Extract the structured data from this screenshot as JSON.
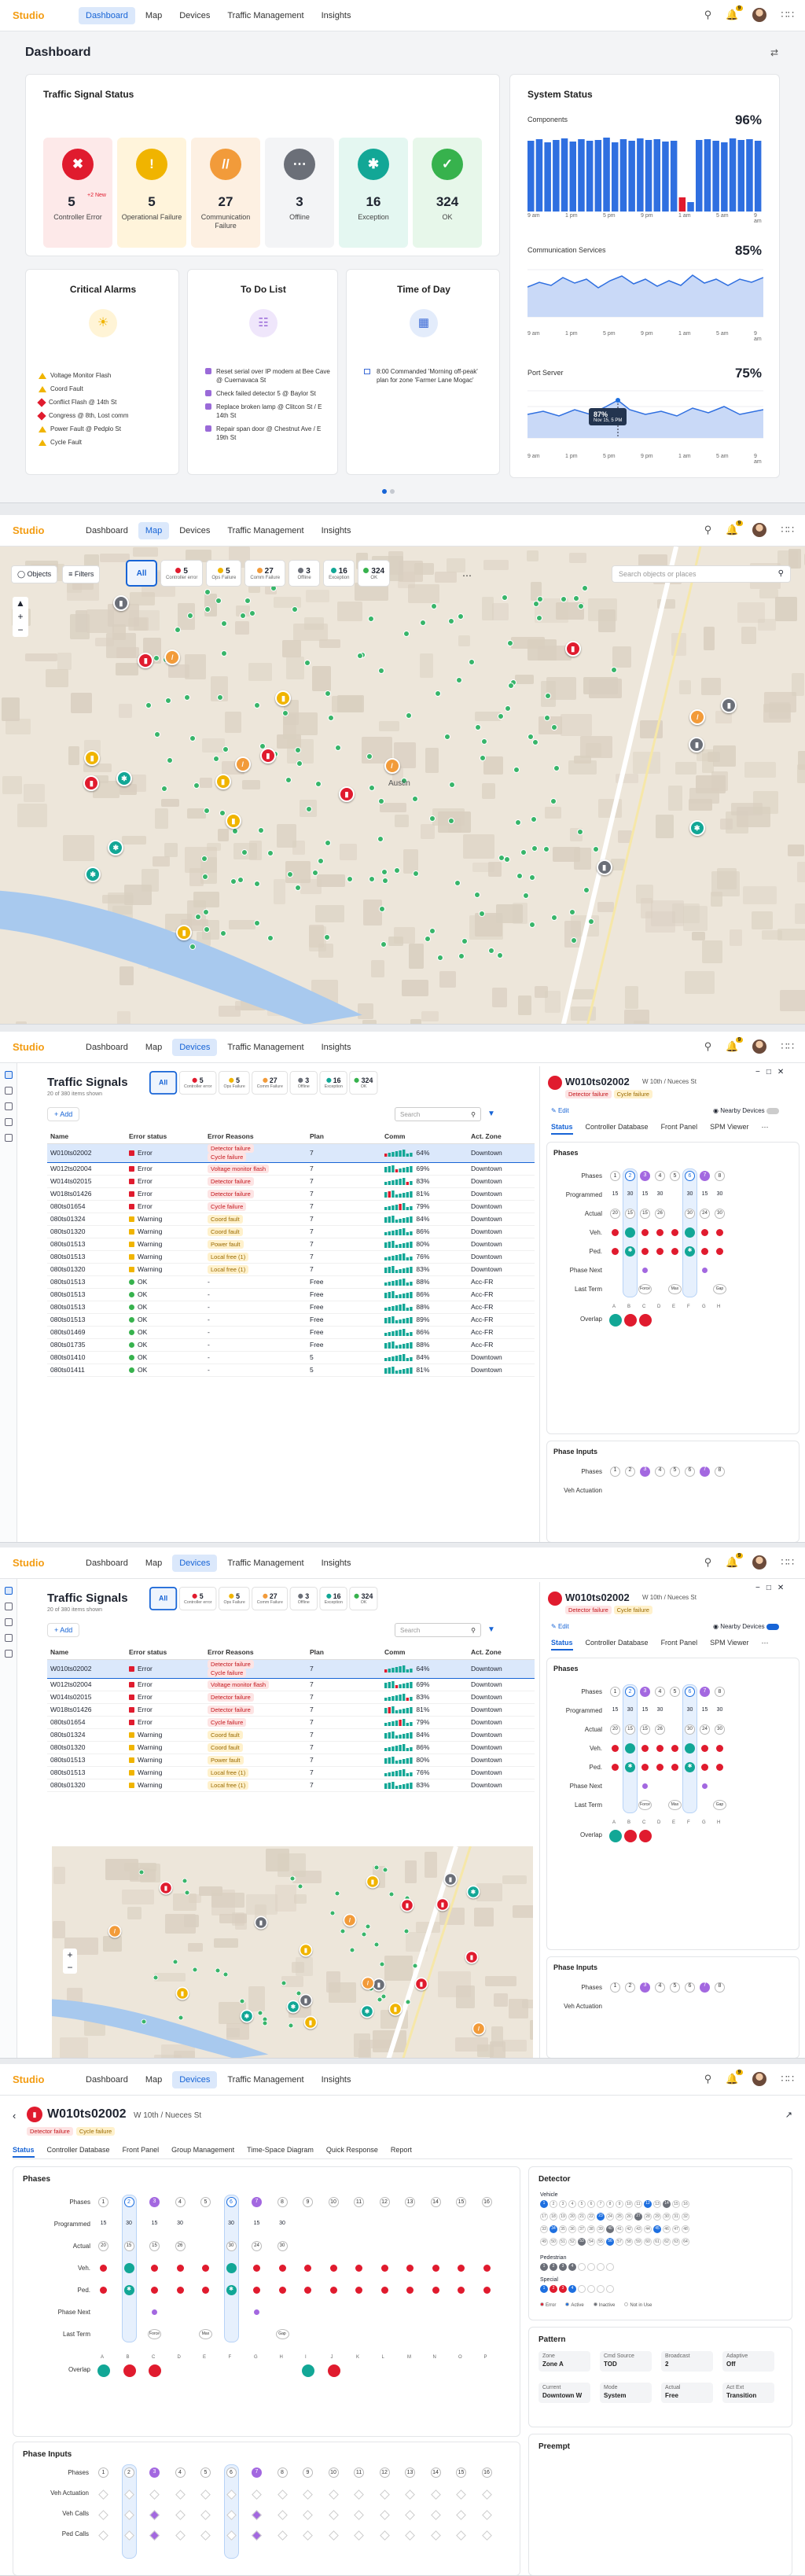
{
  "app": {
    "brand": "Studio",
    "nav": [
      "Dashboard",
      "Map",
      "Devices",
      "Traffic Management",
      "Insights"
    ],
    "bell_count": "9"
  },
  "dashboard": {
    "title": "Dashboard",
    "signal_status": {
      "title": "Traffic Signal Status",
      "tiles": [
        {
          "num": "5",
          "sub": "+2",
          "note": "New",
          "label": "Controller Error",
          "bg": "#fde9e9",
          "ic": "#e01b2e",
          "icon": "diamond-x-icon"
        },
        {
          "num": "5",
          "label": "Operational Failure",
          "bg": "#fff4db",
          "ic": "#f0b400",
          "icon": "warning-icon"
        },
        {
          "num": "27",
          "label": "Communication Failure",
          "bg": "#fdf0e2",
          "ic": "#f29b3a",
          "icon": "no-signal-icon"
        },
        {
          "num": "3",
          "label": "Offline",
          "bg": "#f3f4f6",
          "ic": "#6b6f78",
          "icon": "dots-icon"
        },
        {
          "num": "16",
          "label": "Exception",
          "bg": "#e4f7f1",
          "ic": "#12a796",
          "icon": "asterisk-icon"
        },
        {
          "num": "324",
          "label": "OK",
          "bg": "#e7f7ea",
          "ic": "#37b24d",
          "icon": "check-icon"
        }
      ]
    },
    "critical_alarms": {
      "title": "Critical Alarms",
      "items": [
        {
          "text": "Voltage Monitor Flash",
          "kind": "warn"
        },
        {
          "text": "Coord Fault",
          "kind": "warn"
        },
        {
          "text": "Conflict Flash @ 14th St",
          "kind": "err"
        },
        {
          "text": "Congress @ 8th, Lost comm",
          "kind": "err"
        },
        {
          "text": "Power Fault @ Pedplo St",
          "kind": "warn"
        },
        {
          "text": "Cycle Fault",
          "kind": "warn"
        }
      ]
    },
    "todo": {
      "title": "To Do List",
      "items": [
        "Reset serial over IP modem at Bee Cave @ Cuernavaca St",
        "Check failed detector 5 @ Baylor St",
        "Replace broken lamp @ Clitcon St / E 14th St",
        "Repair span door @ Chestnut Ave / E 19th St"
      ]
    },
    "time_of_day": {
      "title": "Time of Day",
      "text": "8:00 Commanded 'Morning off-peak' plan for zone 'Farmer Lane Mogac'"
    },
    "system_status": {
      "title": "System Status",
      "components": {
        "label": "Components",
        "pct": "96%",
        "ticks": [
          "9 am",
          "1 pm",
          "5 pm",
          "9 pm",
          "1 am",
          "5 am",
          "9 am"
        ]
      },
      "comm": {
        "label": "Communication Services",
        "pct": "85%",
        "ticks": [
          "9 am",
          "1 pm",
          "5 pm",
          "9 pm",
          "1 am",
          "5 am",
          "9 am"
        ]
      },
      "port": {
        "label": "Port Server",
        "pct": "75%",
        "tooltip_pct": "87%",
        "tooltip_time": "Nov 15, 5 PM",
        "ticks": [
          "9 am",
          "1 pm",
          "5 pm",
          "9 pm",
          "1 am",
          "5 am",
          "9 am"
        ]
      }
    }
  },
  "filters": {
    "objects": "Objects",
    "filters": "Filters",
    "search_placeholder": "Search objects or places",
    "chips": [
      {
        "num": "All",
        "label": ""
      },
      {
        "num": "5",
        "label": "Controller error"
      },
      {
        "num": "5",
        "label": "Ops Failure"
      },
      {
        "num": "27",
        "label": "Comm Failure"
      },
      {
        "num": "3",
        "label": "Offline"
      },
      {
        "num": "16",
        "label": "Exception"
      },
      {
        "num": "324",
        "label": "OK"
      }
    ],
    "map_label": "Austin"
  },
  "devices": {
    "title": "Traffic Signals",
    "count": "20 of 380 items shown",
    "add": "Add",
    "search": "Search",
    "cols": [
      "Name",
      "Error status",
      "Error Reasons",
      "Plan",
      "Comm",
      "Act. Zone"
    ],
    "rows": [
      {
        "name": "W010ts02002",
        "st": "Error",
        "r": [
          "Detector failure",
          "Cycle failure"
        ],
        "plan": "7",
        "comm": "64%",
        "zone": "Downtown"
      },
      {
        "name": "W012ts02004",
        "st": "Error",
        "r": [
          "Voltage monitor flash"
        ],
        "plan": "7",
        "comm": "69%",
        "zone": "Downtown"
      },
      {
        "name": "W014ts02015",
        "st": "Error",
        "r": [
          "Detector failure"
        ],
        "plan": "7",
        "comm": "83%",
        "zone": "Downtown"
      },
      {
        "name": "W018ts01426",
        "st": "Error",
        "r": [
          "Detector failure"
        ],
        "plan": "7",
        "comm": "81%",
        "zone": "Downtown"
      },
      {
        "name": "080ts01654",
        "st": "Error",
        "r": [
          "Cycle failure"
        ],
        "plan": "7",
        "comm": "79%",
        "zone": "Downtown"
      },
      {
        "name": "080ts01324",
        "st": "Warning",
        "r": [
          "Coord fault"
        ],
        "plan": "7",
        "comm": "84%",
        "zone": "Downtown"
      },
      {
        "name": "080ts01320",
        "st": "Warning",
        "r": [
          "Coord fault"
        ],
        "plan": "7",
        "comm": "86%",
        "zone": "Downtown"
      },
      {
        "name": "080ts01513",
        "st": "Warning",
        "r": [
          "Power fault"
        ],
        "plan": "7",
        "comm": "80%",
        "zone": "Downtown"
      },
      {
        "name": "080ts01513",
        "st": "Warning",
        "r": [
          "Local free (1)"
        ],
        "plan": "7",
        "comm": "76%",
        "zone": "Downtown"
      },
      {
        "name": "080ts01320",
        "st": "Warning",
        "r": [
          "Local free (1)"
        ],
        "plan": "7",
        "comm": "83%",
        "zone": "Downtown"
      },
      {
        "name": "080ts01513",
        "st": "OK",
        "r": [],
        "plan": "Free",
        "comm": "88%",
        "zone": "Acc-FR"
      },
      {
        "name": "080ts01513",
        "st": "OK",
        "r": [],
        "plan": "Free",
        "comm": "86%",
        "zone": "Acc-FR"
      },
      {
        "name": "080ts01513",
        "st": "OK",
        "r": [],
        "plan": "Free",
        "comm": "88%",
        "zone": "Acc-FR"
      },
      {
        "name": "080ts01513",
        "st": "OK",
        "r": [],
        "plan": "Free",
        "comm": "89%",
        "zone": "Acc-FR"
      },
      {
        "name": "080ts01469",
        "st": "OK",
        "r": [],
        "plan": "Free",
        "comm": "86%",
        "zone": "Acc-FR"
      },
      {
        "name": "080ts01735",
        "st": "OK",
        "r": [],
        "plan": "Free",
        "comm": "88%",
        "zone": "Acc-FR"
      },
      {
        "name": "080ts01410",
        "st": "OK",
        "r": [],
        "plan": "5",
        "comm": "84%",
        "zone": "Downtown"
      },
      {
        "name": "080ts01411",
        "st": "OK",
        "r": [],
        "plan": "5",
        "comm": "81%",
        "zone": "Downtown"
      }
    ]
  },
  "detail": {
    "id": "W010ts02002",
    "street": "W 10th / Nueces St",
    "badges": [
      "Detector failure",
      "Cycle failure"
    ],
    "edit": "Edit",
    "nearby": "Nearby Devices",
    "tabs": [
      "Status",
      "Controller Database",
      "Front Panel",
      "SPM Viewer"
    ],
    "full_tabs": [
      "Status",
      "Controller Database",
      "Front Panel",
      "Group Management",
      "Time-Space Diagram",
      "Quick Response",
      "Report"
    ],
    "phases_title": "Phases",
    "rows": [
      "Phases",
      "Programmed",
      "Actual",
      "Veh.",
      "Ped.",
      "Phase Next",
      "Last Term",
      "Overlap"
    ],
    "programmed": [
      "15",
      "30",
      "15",
      "30",
      "",
      "30",
      "15",
      "30"
    ],
    "actual": [
      "20",
      "15",
      "15",
      "26",
      "",
      "30",
      "24",
      "30"
    ],
    "overlap_letters": [
      "A",
      "B",
      "C",
      "D",
      "E",
      "F",
      "G",
      "H",
      "I",
      "J",
      "K",
      "L",
      "M",
      "N",
      "O",
      "P"
    ],
    "phase_inputs": "Phase Inputs",
    "pi_rows": [
      "Phases",
      "Veh Actuation",
      "Veh Calls",
      "Ped Calls"
    ],
    "detector": {
      "title": "Detector",
      "vehicle": "Vehicle",
      "pedestrian": "Pedestrian",
      "special": "Special",
      "legend": [
        "Error",
        "Active",
        "Inactive",
        "Not in Use"
      ]
    },
    "pattern": {
      "title": "Pattern",
      "fields": [
        {
          "k": "Zone",
          "v": "Zone A"
        },
        {
          "k": "Cmd Source",
          "v": "TOD"
        },
        {
          "k": "Broadcast",
          "v": "2"
        },
        {
          "k": "Adaptive",
          "v": "Off"
        },
        {
          "k": "Current",
          "v": "Downtown W"
        },
        {
          "k": "Mode",
          "v": "System"
        },
        {
          "k": "Actual",
          "v": "Free"
        },
        {
          "k": "Act Ext",
          "v": "Transition"
        }
      ]
    },
    "preempt": "Preempt"
  },
  "colors": {
    "accent": "#1764d6",
    "error": "#e01b2e",
    "warning": "#f0b400",
    "ok": "#37b24d",
    "brand": "#f39c12"
  }
}
